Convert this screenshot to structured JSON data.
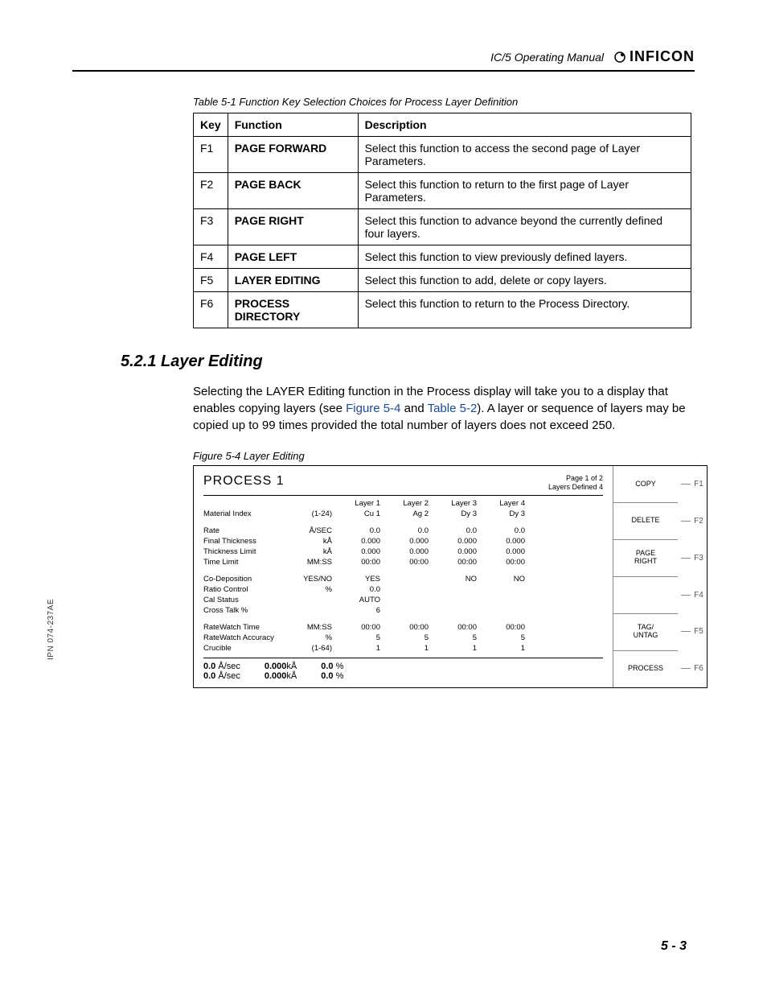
{
  "header": {
    "manual_title": "IC/5 Operating Manual",
    "brand": "INFICON"
  },
  "table_caption": "Table 5-1  Function Key Selection Choices for Process Layer Definition",
  "table_headers": {
    "key": "Key",
    "function": "Function",
    "description": "Description"
  },
  "table_rows": [
    {
      "key": "F1",
      "fn": "PAGE FORWARD",
      "desc": "Select this function to access the second page of Layer Parameters."
    },
    {
      "key": "F2",
      "fn": "PAGE BACK",
      "desc": "Select this function to return to the first page of Layer Parameters."
    },
    {
      "key": "F3",
      "fn": "PAGE RIGHT",
      "desc": "Select this function to advance beyond the currently defined four layers."
    },
    {
      "key": "F4",
      "fn": "PAGE LEFT",
      "desc": "Select this function to view previously defined layers."
    },
    {
      "key": "F5",
      "fn": "LAYER EDITING",
      "desc": "Select this function to add, delete or copy layers."
    },
    {
      "key": "F6",
      "fn": "PROCESS DIRECTORY",
      "desc": "Select this function to return to the Process Directory."
    }
  ],
  "section_heading": "5.2.1  Layer Editing",
  "paragraph": {
    "p1": "Selecting the LAYER Editing function in the Process display will take you to a display that enables copying layers (see ",
    "xref1": "Figure 5-4",
    "p2": " and ",
    "xref2": "Table 5-2",
    "p3": "). A layer or sequence of layers may be copied up to 99 times provided the total number of layers does not exceed 250."
  },
  "figure_caption": "Figure 5-4  Layer Editing",
  "figure": {
    "title": "PROCESS 1",
    "page_info1": "Page 1 of 2",
    "page_info2": "Layers Defined 4",
    "col_headers": [
      "Layer 1",
      "Layer 2",
      "Layer 3",
      "Layer 4"
    ],
    "rows": [
      {
        "label": "Material Index",
        "unit": "(1-24)",
        "vals": [
          "Cu    1",
          "Ag    2",
          "Dy    3",
          "Dy    3"
        ]
      },
      {
        "label": "Rate",
        "unit": "Å/SEC",
        "vals": [
          "0.0",
          "0.0",
          "0.0",
          "0.0"
        ]
      },
      {
        "label": "Final Thickness",
        "unit": "kÅ",
        "vals": [
          "0.000",
          "0.000",
          "0.000",
          "0.000"
        ]
      },
      {
        "label": "Thickness Limit",
        "unit": "kÅ",
        "vals": [
          "0.000",
          "0.000",
          "0.000",
          "0.000"
        ]
      },
      {
        "label": "Time Limit",
        "unit": "MM:SS",
        "vals": [
          "00:00",
          "00:00",
          "00:00",
          "00:00"
        ]
      },
      {
        "label": "Co-Deposition",
        "unit": "YES/NO",
        "vals": [
          "YES",
          "",
          "NO",
          "NO"
        ]
      },
      {
        "label": "Ratio Control",
        "unit": "%",
        "vals": [
          "0.0",
          "",
          "",
          ""
        ]
      },
      {
        "label": "Cal Status",
        "unit": "",
        "vals": [
          "AUTO",
          "",
          "",
          ""
        ]
      },
      {
        "label": "Cross Talk %",
        "unit": "",
        "vals": [
          "6",
          "",
          "",
          ""
        ]
      },
      {
        "label": "RateWatch Time",
        "unit": "MM:SS",
        "vals": [
          "00:00",
          "00:00",
          "00:00",
          "00:00"
        ]
      },
      {
        "label": "RateWatch Accuracy",
        "unit": "%",
        "vals": [
          "5",
          "5",
          "5",
          "5"
        ]
      },
      {
        "label": "Crucible",
        "unit": "(1-64)",
        "vals": [
          "1",
          "1",
          "1",
          "1"
        ]
      }
    ],
    "footer": {
      "rate1": "0.0",
      "rate_unit": "Å/sec",
      "rate2": "0.0",
      "thk1": "0.000",
      "thk_unit": "kÅ",
      "thk2": "0.000",
      "pct1": "0.0",
      "pct_unit": "%",
      "pct2": "0.0"
    },
    "side_buttons": [
      "COPY",
      "DELETE",
      "PAGE\nRIGHT",
      "",
      "TAG/\nUNTAG",
      "PROCESS"
    ],
    "f_labels": [
      "F1",
      "F2",
      "F3",
      "F4",
      "F5",
      "F6"
    ]
  },
  "side_text": "IPN 074-237AE",
  "page_number": "5 - 3"
}
